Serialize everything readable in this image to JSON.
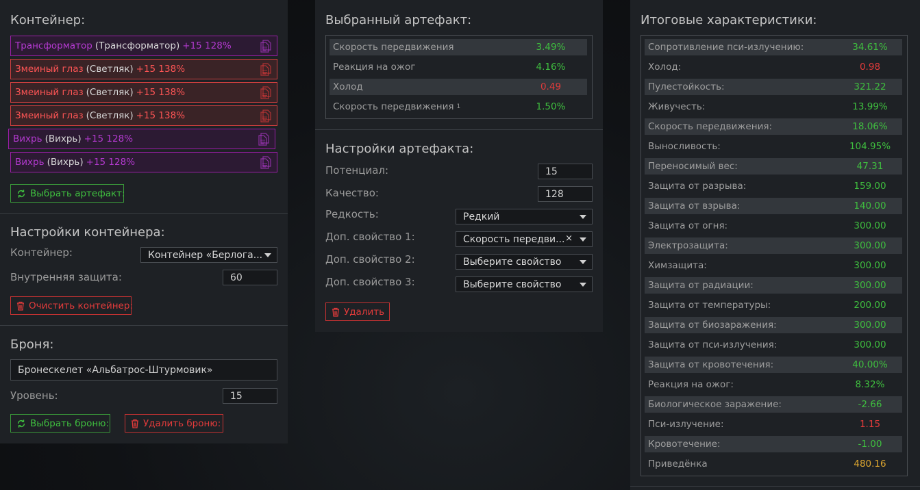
{
  "container": {
    "title": "Контейнер:",
    "artifacts": [
      {
        "name": "Трансформатор",
        "sub": "(Трансформатор)",
        "level": "+15 128%",
        "color": "purple"
      },
      {
        "name": "Змеиный глаз",
        "sub": "(Светляк)",
        "level": "+15 138%",
        "color": "red"
      },
      {
        "name": "Змеиный глаз",
        "sub": "(Светляк)",
        "level": "+15 138%",
        "color": "red"
      },
      {
        "name": "Змеиный глаз",
        "sub": "(Светляк)",
        "level": "+15 138%",
        "color": "red"
      },
      {
        "name": "Вихрь",
        "sub": "(Вихрь)",
        "level": "+15 128%",
        "color": "purple"
      },
      {
        "name": "Вихрь",
        "sub": "(Вихрь)",
        "level": "+15 128%",
        "color": "purple"
      }
    ],
    "choose_artifact_label": "Выбрать артефакт:"
  },
  "container_settings": {
    "title": "Настройки контейнера:",
    "container_label": "Контейнер:",
    "container_value": "Контейнер «Берлога...",
    "inner_protection_label": "Внутренняя защита:",
    "inner_protection_value": "60",
    "clear_label": "Очистить контейнер:"
  },
  "armor": {
    "title": "Броня:",
    "name": "Бронескелет «Альбатрос-Штурмовик»",
    "level_label": "Уровень:",
    "level_value": "15",
    "choose_label": "Выбрать броню:",
    "delete_label": "Удалить броню:"
  },
  "selected_artifact": {
    "title": "Выбранный артефакт:",
    "stats": [
      {
        "name": "Скорость передвижения",
        "value": "3.49%",
        "color": "green",
        "sup": ""
      },
      {
        "name": "Реакция на ожог",
        "value": "4.16%",
        "color": "green",
        "sup": ""
      },
      {
        "name": "Холод",
        "value": "0.49",
        "color": "red",
        "sup": ""
      },
      {
        "name": "Скорость передвижения",
        "value": "1.50%",
        "color": "green",
        "sup": "1"
      }
    ]
  },
  "artifact_settings": {
    "title": "Настройки артефакта:",
    "potential_label": "Потенциал:",
    "potential_value": "15",
    "quality_label": "Качество:",
    "quality_value": "128",
    "rarity_label": "Редкость:",
    "rarity_value": "Редкий",
    "prop1_label": "Доп. свойство 1:",
    "prop1_value": "Скорость передви...",
    "prop2_label": "Доп. свойство 2:",
    "prop2_value": "Выберите свойство",
    "prop3_label": "Доп. свойство 3:",
    "prop3_value": "Выберите свойство",
    "delete_label": "Удалить"
  },
  "totals": {
    "title": "Итоговые характеристики:",
    "stats": [
      {
        "name": "Сопротивление пси-излучению:",
        "value": "34.61%",
        "color": "green"
      },
      {
        "name": "Холод:",
        "value": "0.98",
        "color": "red"
      },
      {
        "name": "Пулестойкость:",
        "value": "321.22",
        "color": "green"
      },
      {
        "name": "Живучесть:",
        "value": "13.99%",
        "color": "green"
      },
      {
        "name": "Скорость передвижения:",
        "value": "18.06%",
        "color": "green"
      },
      {
        "name": "Выносливость:",
        "value": "104.95%",
        "color": "green"
      },
      {
        "name": "Переносимый вес:",
        "value": "47.31",
        "color": "green"
      },
      {
        "name": "Защита от разрыва:",
        "value": "159.00",
        "color": "green"
      },
      {
        "name": "Защита от взрыва:",
        "value": "140.00",
        "color": "green"
      },
      {
        "name": "Защита от огня:",
        "value": "300.00",
        "color": "green"
      },
      {
        "name": "Электрозащита:",
        "value": "300.00",
        "color": "green"
      },
      {
        "name": "Химзащита:",
        "value": "300.00",
        "color": "green"
      },
      {
        "name": "Защита от радиации:",
        "value": "300.00",
        "color": "green"
      },
      {
        "name": "Защита от температуры:",
        "value": "200.00",
        "color": "green"
      },
      {
        "name": "Защита от биозаражения:",
        "value": "300.00",
        "color": "green"
      },
      {
        "name": "Защита от пси-излучения:",
        "value": "300.00",
        "color": "green"
      },
      {
        "name": "Защита от кровотечения:",
        "value": "40.00%",
        "color": "green"
      },
      {
        "name": "Реакция на ожог:",
        "value": "8.32%",
        "color": "green"
      },
      {
        "name": "Биологическое заражение:",
        "value": "-2.66",
        "color": "green"
      },
      {
        "name": "Пси-излучение:",
        "value": "1.15",
        "color": "red"
      },
      {
        "name": "Кровотечение:",
        "value": "-1.00",
        "color": "green"
      },
      {
        "name": "Приведёнка",
        "value": "480.16",
        "color": "gold"
      }
    ]
  },
  "colors": {
    "green": "#3fbf3f",
    "red": "#e23b3b",
    "gold": "#e0a830",
    "purple": "#b43ad0"
  },
  "icons": {
    "artifact_copy": "document-copy-icon",
    "refresh": "refresh-icon",
    "trash": "trash-icon",
    "dropdown": "chevron-down-icon",
    "clear": "close-icon"
  }
}
